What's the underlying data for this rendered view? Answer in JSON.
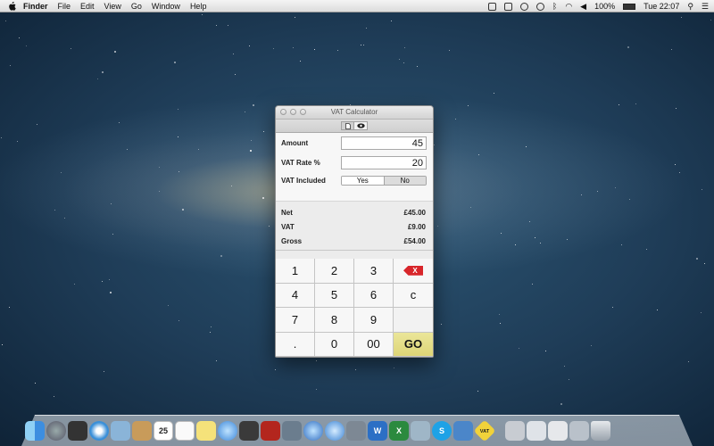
{
  "menubar": {
    "app_name": "Finder",
    "items": [
      "File",
      "Edit",
      "View",
      "Go",
      "Window",
      "Help"
    ],
    "battery": "100%",
    "clock": "Tue 22:07"
  },
  "window": {
    "title": "VAT Calculator",
    "amount": {
      "label": "Amount",
      "value": "45"
    },
    "vat_rate": {
      "label": "VAT Rate %",
      "value": "20"
    },
    "vat_included": {
      "label": "VAT Included",
      "yes": "Yes",
      "no": "No",
      "selected": "No"
    },
    "results": {
      "net_label": "Net",
      "net_value": "£45.00",
      "vat_label": "VAT",
      "vat_value": "£9.00",
      "gross_label": "Gross",
      "gross_value": "£54.00"
    },
    "keys": [
      "1",
      "2",
      "3",
      "X",
      "4",
      "5",
      "6",
      "c",
      "7",
      "8",
      "9",
      "",
      ".",
      "0",
      "00",
      "GO"
    ]
  },
  "dock": {
    "calendar_day": "25",
    "vat_badge": "VAT"
  }
}
